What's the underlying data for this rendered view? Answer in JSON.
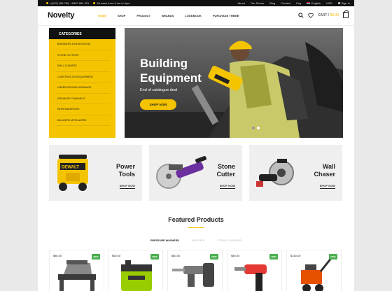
{
  "topbar": {
    "phones": "+(012) 456 789, +0987 654 321",
    "hours": "All week from 9 am to 9pm",
    "links": [
      "About",
      "Our Stores",
      "Blog",
      "Contact",
      "Faq"
    ],
    "language": "English",
    "currency": "USD",
    "signin": "Sign In"
  },
  "header": {
    "logo": "Novelty",
    "nav": [
      "HOME",
      "SHOP",
      "PRODUCT",
      "BRANDS",
      "LOOKBOOK",
      "PURCHASE THEME"
    ],
    "cart_label": "CART /",
    "cart_amount": "$0.00"
  },
  "categories": {
    "title": "CATEGORIES",
    "items": [
      "BREAKERS & DEMOLITION",
      "STONE CUTTERS",
      "WALL CHASERS",
      "CONSTRUCTION EQUIPMENT",
      "UNDERGROUND DRAINAGE",
      "DRAINAGE CHANNELS",
      "WHEELBARROWS",
      "BUILDERS METALWORK"
    ]
  },
  "hero": {
    "title_line1": "Building",
    "title_line2": "Equipment",
    "subtitle": "End of catalogue deal",
    "button": "SHOP NOW"
  },
  "promos": [
    {
      "line1": "Power",
      "line2": "Tools",
      "link": "SHOP NOW"
    },
    {
      "line1": "Stone",
      "line2": "Cutter",
      "link": "SHOP NOW"
    },
    {
      "line1": "Wall",
      "line2": "Chaser",
      "link": "SHOP NOW"
    }
  ],
  "featured": {
    "title": "Featured Products",
    "tabs": [
      "PRESSURE WASHERS",
      "KARCHER",
      "STEAM CLEANERS"
    ]
  },
  "products": [
    {
      "price": "$80.00",
      "badge": "NEW"
    },
    {
      "price": "$60.00",
      "badge": "NEW"
    },
    {
      "price": "$80.00",
      "badge": "NEW"
    },
    {
      "price": "$80.00",
      "badge": "NEW"
    },
    {
      "price": "$150.00",
      "badge": "NEW"
    }
  ],
  "colors": {
    "accent": "#f5c400",
    "dark": "#111111",
    "badge": "#4caf50"
  }
}
